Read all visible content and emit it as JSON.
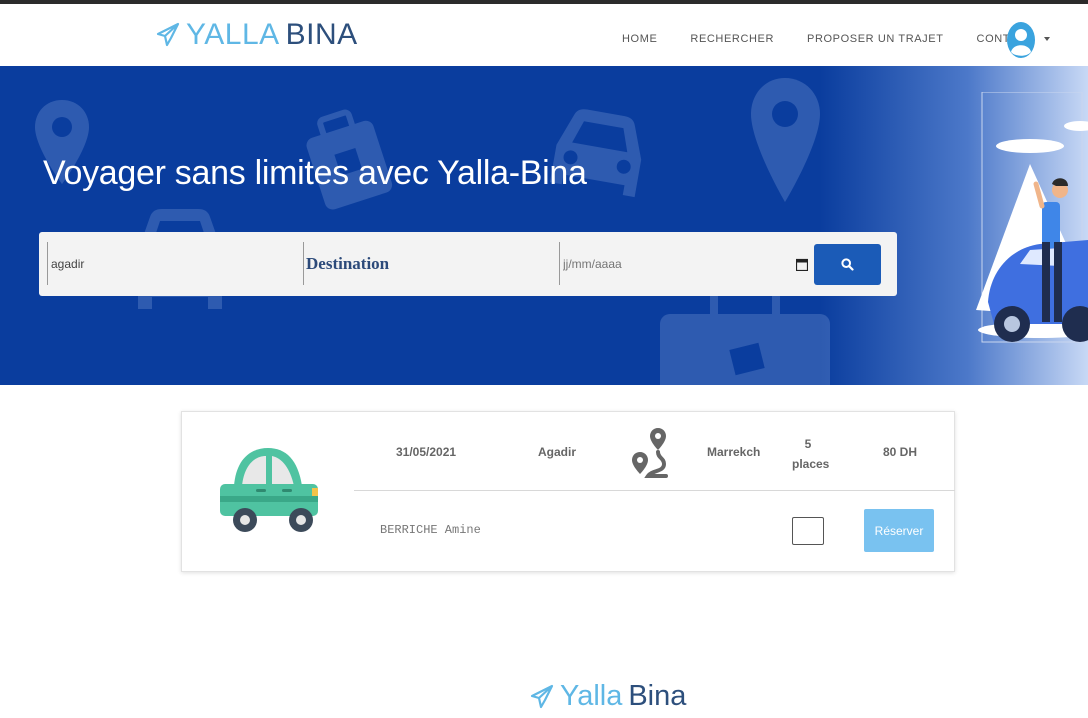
{
  "header": {
    "brand_part1": "YALLA",
    "brand_part2": "BINA",
    "nav": [
      "HOME",
      "RECHERCHER",
      "PROPOSER UN TRAJET",
      "CONTACT"
    ],
    "avatar_icon": "user-avatar-icon"
  },
  "hero": {
    "title": "Voyager sans limites avec Yalla-Bina"
  },
  "search": {
    "origin_value": "agadir",
    "destination_label": "Destination",
    "date_placeholder": "jj/mm/aaaa",
    "search_icon": "search-icon"
  },
  "trip": {
    "date": "31/05/2021",
    "from": "Agadir",
    "to": "Marrekch",
    "places_count": "5",
    "places_label": "places",
    "price": "80 DH",
    "driver": "BERRICHE Amine",
    "reserve_label": "Réserver"
  },
  "footer": {
    "brand_part1": "Yalla",
    "brand_part2": "Bina"
  },
  "colors": {
    "hero_bg": "#0a3d9e",
    "brand_light": "#5fb7e5",
    "brand_dark": "#2d4f7c",
    "search_button": "#1b5bb7",
    "reserve_button": "#79c2f0"
  }
}
